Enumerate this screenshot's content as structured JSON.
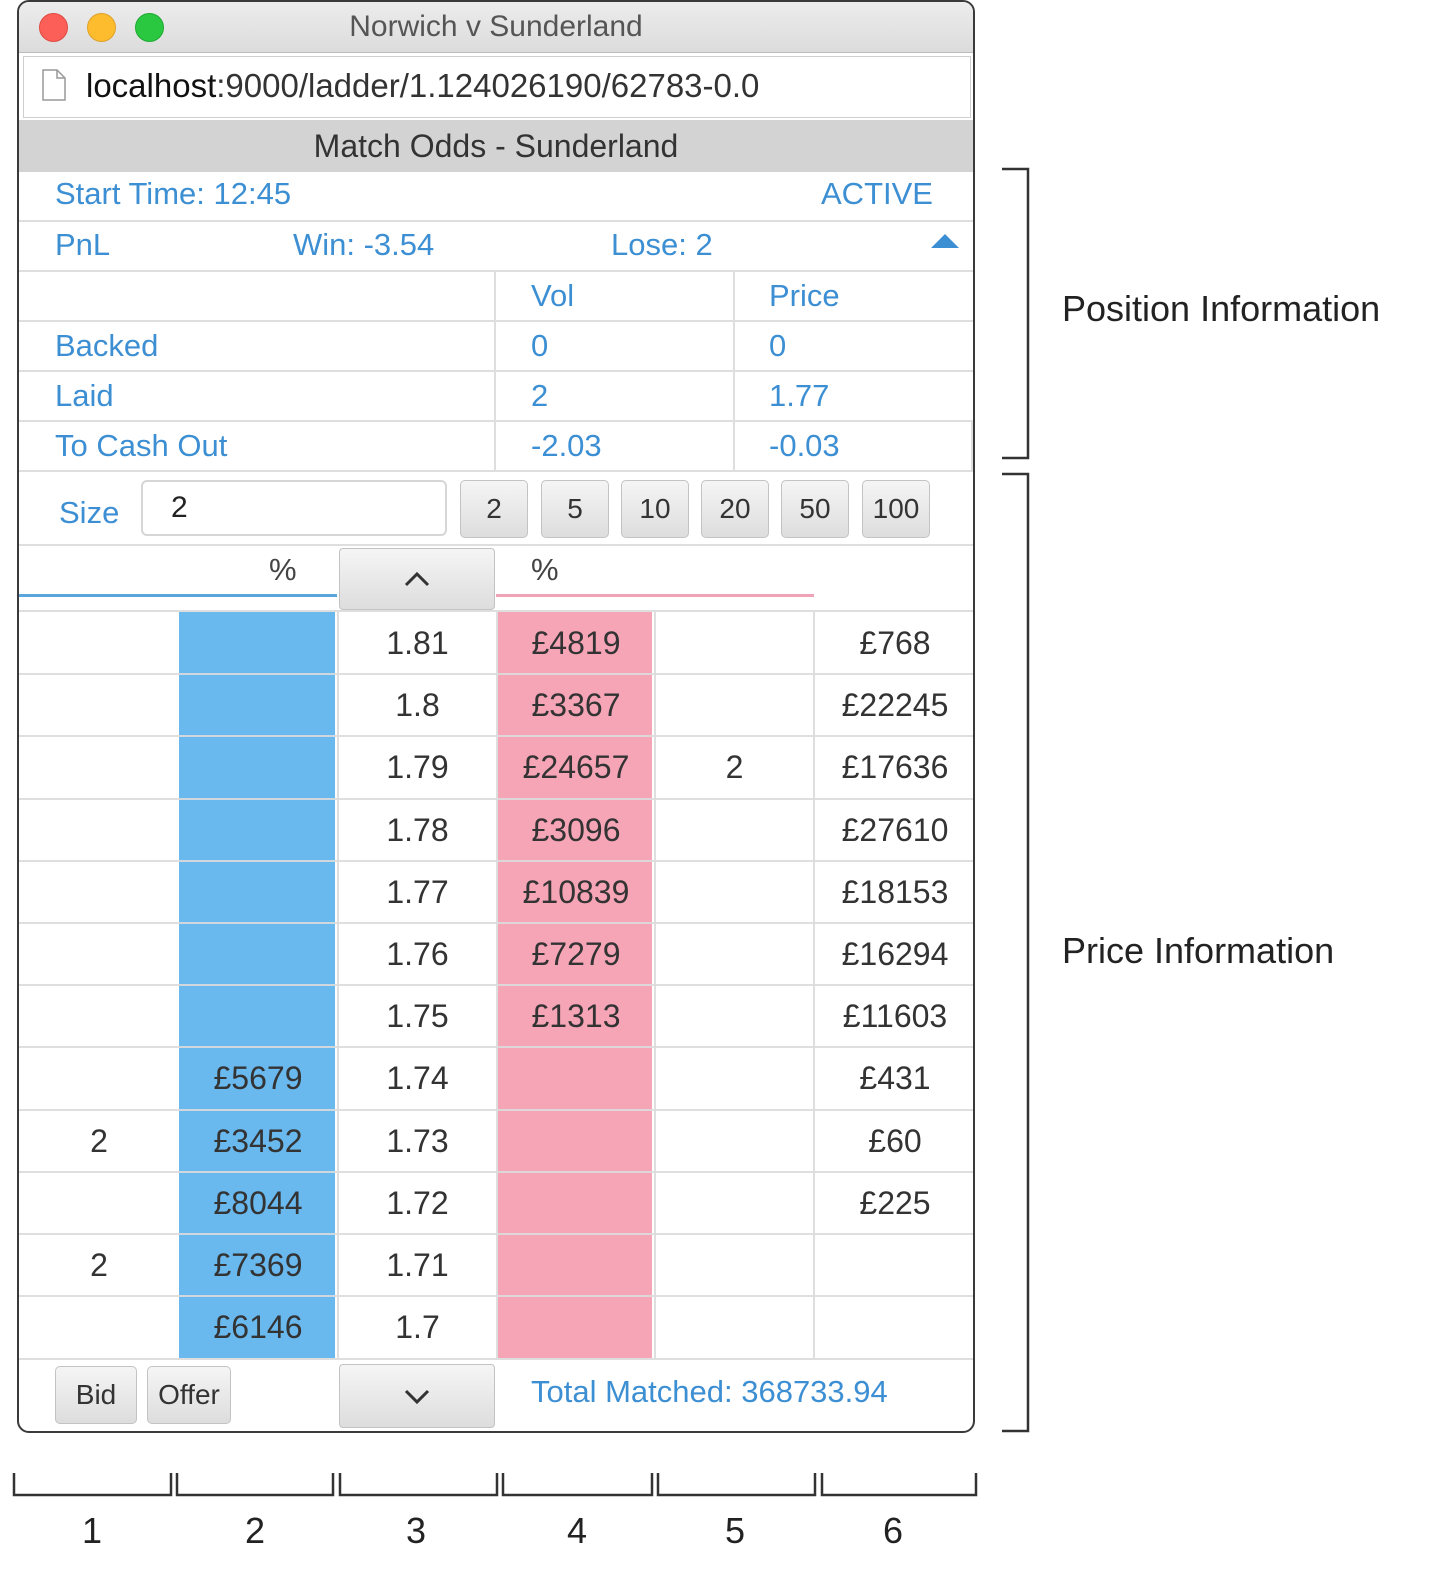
{
  "window": {
    "title": "Norwich v Sunderland",
    "url_host": "localhost",
    "url_path": ":9000/ladder/1.124026190/62783-0.0",
    "market_name": "Match Odds - Sunderland"
  },
  "info": {
    "start_time": "Start Time: 12:45",
    "status": "ACTIVE",
    "pnl_label": "PnL",
    "win": "Win: -3.54",
    "lose": "Lose: 2"
  },
  "position": {
    "headers": [
      "",
      "Vol",
      "Price"
    ],
    "rows": [
      {
        "label": "Backed",
        "vol": "0",
        "price": "0"
      },
      {
        "label": "Laid",
        "vol": "2",
        "price": "1.77"
      },
      {
        "label": "To Cash Out",
        "vol": "-2.03",
        "price": "-0.03"
      }
    ]
  },
  "size": {
    "label": "Size",
    "value": "2",
    "presets": [
      "2",
      "5",
      "10",
      "20",
      "50",
      "100"
    ]
  },
  "ladder": {
    "left_header": "%",
    "right_header": "%",
    "rows": [
      {
        "my_bid": "",
        "bid": "",
        "price": "1.81",
        "ask": "£4819",
        "my_ask": "",
        "traded": "£768"
      },
      {
        "my_bid": "",
        "bid": "",
        "price": "1.8",
        "ask": "£3367",
        "my_ask": "",
        "traded": "£22245"
      },
      {
        "my_bid": "",
        "bid": "",
        "price": "1.79",
        "ask": "£24657",
        "my_ask": "2",
        "traded": "£17636"
      },
      {
        "my_bid": "",
        "bid": "",
        "price": "1.78",
        "ask": "£3096",
        "my_ask": "",
        "traded": "£27610"
      },
      {
        "my_bid": "",
        "bid": "",
        "price": "1.77",
        "ask": "£10839",
        "my_ask": "",
        "traded": "£18153"
      },
      {
        "my_bid": "",
        "bid": "",
        "price": "1.76",
        "ask": "£7279",
        "my_ask": "",
        "traded": "£16294"
      },
      {
        "my_bid": "",
        "bid": "",
        "price": "1.75",
        "ask": "£1313",
        "my_ask": "",
        "traded": "£11603"
      },
      {
        "my_bid": "",
        "bid": "£5679",
        "price": "1.74",
        "ask": "",
        "my_ask": "",
        "traded": "£431"
      },
      {
        "my_bid": "2",
        "bid": "£3452",
        "price": "1.73",
        "ask": "",
        "my_ask": "",
        "traded": "£60"
      },
      {
        "my_bid": "",
        "bid": "£8044",
        "price": "1.72",
        "ask": "",
        "my_ask": "",
        "traded": "£225"
      },
      {
        "my_bid": "2",
        "bid": "£7369",
        "price": "1.71",
        "ask": "",
        "my_ask": "",
        "traded": ""
      },
      {
        "my_bid": "",
        "bid": "£6146",
        "price": "1.7",
        "ask": "",
        "my_ask": "",
        "traded": ""
      }
    ]
  },
  "footer": {
    "bid_label": "Bid",
    "offer_label": "Offer",
    "total_matched": "Total Matched: 368733.94"
  },
  "annotations": {
    "position_information": "Position Information",
    "price_information": "Price Information",
    "column_numbers": [
      "1",
      "2",
      "3",
      "4",
      "5",
      "6"
    ]
  },
  "colors": {
    "bid_blue": "#69b8ee",
    "ask_pink": "#f6a5b7",
    "text_blue": "#3d8fd3"
  },
  "icons": {
    "scroll_up": "chevron-up-icon",
    "scroll_down": "chevron-down-icon",
    "collapse": "triangle-up-icon",
    "page": "document-icon"
  }
}
